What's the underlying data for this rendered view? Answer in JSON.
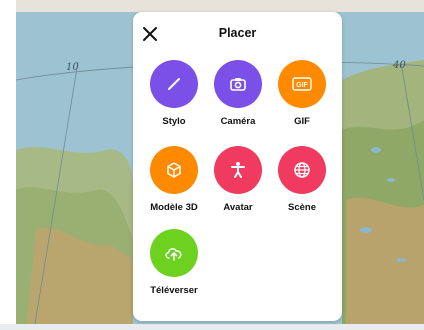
{
  "map": {
    "grid_labels": [
      "10",
      "40"
    ],
    "colors": {
      "sea": "#99c0d0",
      "land": "#9bb37a",
      "mountain": "#c8b07a"
    }
  },
  "panel": {
    "title": "Placer",
    "close_icon": "close-icon",
    "tools": [
      {
        "id": "pen",
        "label": "Stylo",
        "color": "#7b50e8",
        "icon": "pen-icon"
      },
      {
        "id": "camera",
        "label": "Caméra",
        "color": "#7b50e8",
        "icon": "camera-icon"
      },
      {
        "id": "gif",
        "label": "GIF",
        "color": "#ff8a00",
        "icon": "gif-icon",
        "icon_text": "GIF"
      },
      {
        "id": "model3d",
        "label": "Modèle 3D",
        "color": "#ff8a00",
        "icon": "cube-icon"
      },
      {
        "id": "avatar",
        "label": "Avatar",
        "color": "#f03a5f",
        "icon": "avatar-icon"
      },
      {
        "id": "scene",
        "label": "Scène",
        "color": "#f03a5f",
        "icon": "globe-icon"
      },
      {
        "id": "upload",
        "label": "Téléverser",
        "color": "#6cd11f",
        "icon": "cloud-upload-icon"
      }
    ]
  }
}
